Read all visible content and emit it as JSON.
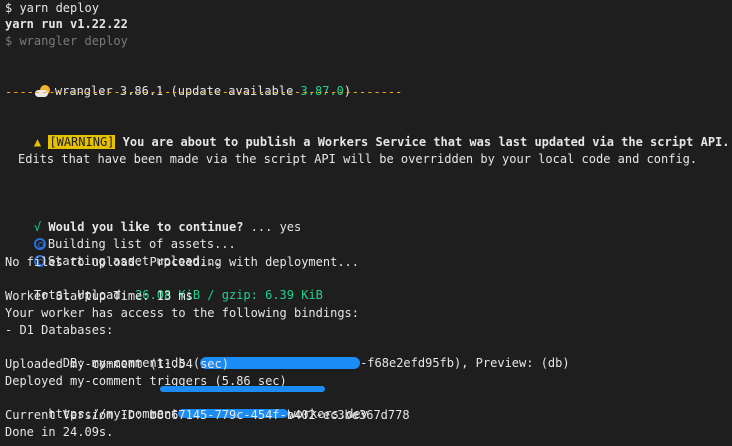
{
  "lines": {
    "cmd": "$ yarn deploy",
    "yarn_run": "yarn run v1.22.22",
    "wrangler_cmd": "$ wrangler deploy",
    "wrangler_name": "wrangler 3.86.1 (update available ",
    "wrangler_update": "3.87.0",
    "wrangler_close": ")",
    "dashes": "-------------------------------------------------------",
    "warn_icon": "▲",
    "warn_badge": "[WARNING]",
    "warn_text": "You are about to publish a Workers Service that was last updated via the script API.",
    "edits_text": "Edits that have been made via the script API will be overridden by your local code and config.",
    "check": "√",
    "continue_q": "Would you like to continue?",
    "continue_a": " ... yes",
    "building": "Building list of assets...",
    "starting": "Starting asset upload...",
    "no_files": "No files to upload. Proceeding with deployment...",
    "total_upload_label": "Total Upload: ",
    "total_upload_value": "26.08 KiB / gzip: 6.39 KiB",
    "startup": "Worker Startup Time: 13 ms",
    "bindings": "Your worker has access to the following bindings:",
    "d1": "- D1 Databases:",
    "db_prefix": "  - DB: my-comment-db (",
    "db_suffix": "-f68e2efd95fb), Preview: (db)",
    "uploaded": "Uploaded my-comment (11.54 sec)",
    "deployed": "Deployed my-comment triggers (5.86 sec)",
    "url_prefix": "  https://my-comment",
    "url_suffix": "workers.dev",
    "version": "Current Version ID: b8c67145-779c-454f-b402-ec3be367d778",
    "done": "Done in 24.09s."
  },
  "colors": {
    "background": "#1e1e1e",
    "text": "#cccccc",
    "green": "#23d18b",
    "orange": "#f5a623",
    "warning": "#e5c100",
    "redaction": "#1b8cf5"
  },
  "icons": {
    "cloud": "sun-behind-cloud-icon",
    "spinner": "cyclone-spinner-icon",
    "warning": "warning-triangle-icon",
    "check": "check-icon"
  }
}
